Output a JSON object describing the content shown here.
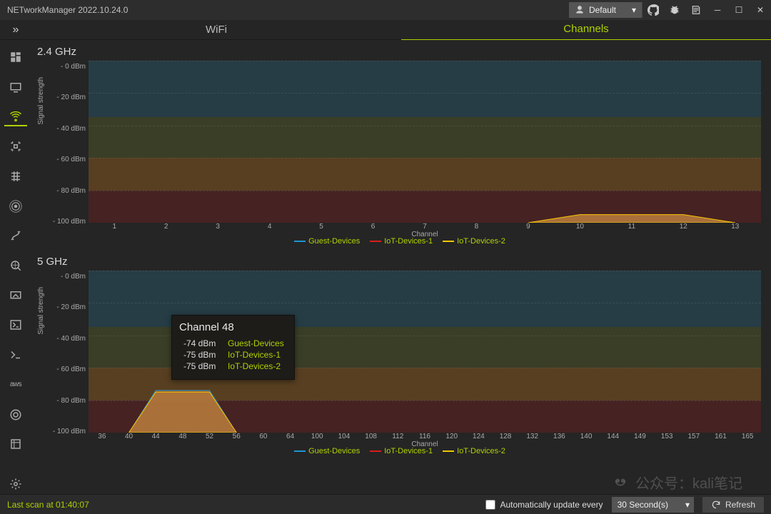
{
  "app_title": "NETworkManager 2022.10.24.0",
  "user_label": "Default",
  "tabs": {
    "wifi": "WiFi",
    "channels": "Channels"
  },
  "sections": {
    "g24": "2.4 GHz",
    "g5": "5 GHz"
  },
  "axis": {
    "ylabel": "Signal strength",
    "xlabel": "Channel",
    "yticks": [
      "- 0 dBm",
      "- 20 dBm",
      "- 40 dBm",
      "- 60 dBm",
      "- 80 dBm",
      "- 100 dBm"
    ]
  },
  "legend": {
    "a": "Guest-Devices",
    "b": "IoT-Devices-1",
    "c": "IoT-Devices-2"
  },
  "colors": {
    "series_a": "#1d95d2",
    "series_b": "#d51e1e",
    "series_c": "#f1c700",
    "accent": "#b0d100",
    "band_blue": "rgba(40,90,110,0.45)",
    "band_green": "rgba(90,100,40,0.40)",
    "band_orange": "rgba(150,95,30,0.45)",
    "band_red": "rgba(110,30,30,0.45)",
    "fill": "rgba(180,120,60,0.55)"
  },
  "tooltip": {
    "title": "Channel 48",
    "rows": [
      {
        "val": "-74 dBm",
        "name": "Guest-Devices",
        "color": "#1d95d2"
      },
      {
        "val": "-75 dBm",
        "name": "IoT-Devices-1",
        "color": "#d51e1e"
      },
      {
        "val": "-75 dBm",
        "name": "IoT-Devices-2",
        "color": "#f1c700"
      }
    ]
  },
  "footer": {
    "last_scan": "Last scan at 01:40:07",
    "auto_label": "Automatically update every",
    "interval": "30 Second(s)",
    "refresh": "Refresh"
  },
  "watermark": "公众号：kali笔记",
  "chart_data": [
    {
      "type": "area",
      "title": "2.4 GHz",
      "ylabel": "Signal strength",
      "xlabel": "Channel",
      "x_ticks": [
        1,
        2,
        3,
        4,
        5,
        6,
        7,
        8,
        9,
        10,
        11,
        12,
        13
      ],
      "ylim": [
        -100,
        0
      ],
      "series": [
        {
          "name": "Guest-Devices",
          "color": "#1d95d2",
          "channel": 11,
          "signal_dbm": -95,
          "span": [
            9,
            13
          ]
        },
        {
          "name": "IoT-Devices-1",
          "color": "#d51e1e",
          "channel": 11,
          "signal_dbm": -95,
          "span": [
            9,
            13
          ]
        },
        {
          "name": "IoT-Devices-2",
          "color": "#f1c700",
          "channel": 11,
          "signal_dbm": -95,
          "span": [
            9,
            13
          ]
        }
      ],
      "bands": [
        {
          "from": 0,
          "to": -35,
          "color": "rgba(40,90,110,0.45)"
        },
        {
          "from": -35,
          "to": -60,
          "color": "rgba(90,100,40,0.40)"
        },
        {
          "from": -60,
          "to": -80,
          "color": "rgba(150,95,30,0.45)"
        },
        {
          "from": -80,
          "to": -100,
          "color": "rgba(110,30,30,0.45)"
        }
      ]
    },
    {
      "type": "area",
      "title": "5 GHz",
      "ylabel": "Signal strength",
      "xlabel": "Channel",
      "x_ticks": [
        36,
        40,
        44,
        48,
        52,
        56,
        60,
        64,
        100,
        104,
        108,
        112,
        116,
        120,
        124,
        128,
        132,
        136,
        140,
        144,
        149,
        153,
        157,
        161,
        165
      ],
      "ylim": [
        -100,
        0
      ],
      "series": [
        {
          "name": "Guest-Devices",
          "color": "#1d95d2",
          "channel": 48,
          "signal_dbm": -74,
          "span": [
            40,
            56
          ]
        },
        {
          "name": "IoT-Devices-1",
          "color": "#d51e1e",
          "channel": 48,
          "signal_dbm": -75,
          "span": [
            40,
            56
          ]
        },
        {
          "name": "IoT-Devices-2",
          "color": "#f1c700",
          "channel": 48,
          "signal_dbm": -75,
          "span": [
            40,
            56
          ]
        }
      ],
      "bands": [
        {
          "from": 0,
          "to": -35,
          "color": "rgba(40,90,110,0.45)"
        },
        {
          "from": -35,
          "to": -60,
          "color": "rgba(90,100,40,0.40)"
        },
        {
          "from": -60,
          "to": -80,
          "color": "rgba(150,95,30,0.45)"
        },
        {
          "from": -80,
          "to": -100,
          "color": "rgba(110,30,30,0.45)"
        }
      ]
    }
  ]
}
